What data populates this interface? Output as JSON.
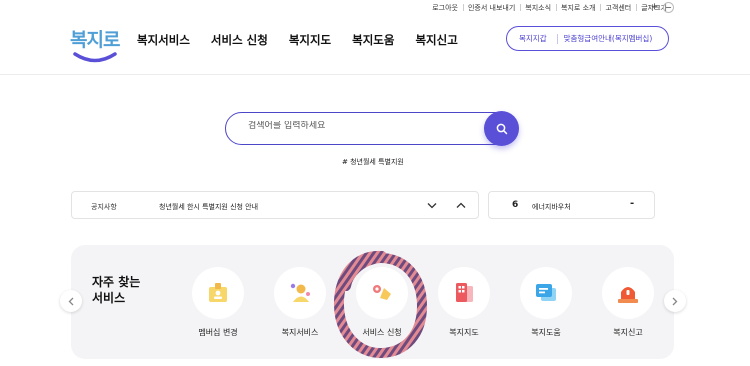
{
  "util_links": [
    "로그아웃",
    "인증서 내보내기",
    "복지소식",
    "복지로 소개",
    "고객센터",
    "글자크기"
  ],
  "font_size": {
    "increase": "+",
    "decrease": "−"
  },
  "logo": {
    "text": "복지로"
  },
  "gnb": [
    "복지서비스",
    "서비스 신청",
    "복지지도",
    "복지도움",
    "복지신고"
  ],
  "header_buttons": {
    "wallet": "복지지갑",
    "membership": "맞춤형급여안내(복지멤버십)"
  },
  "search": {
    "placeholder": "검색어를 입력하세요",
    "hashtag": "# 청년월세 특별지원"
  },
  "notice": {
    "label": "공지사항",
    "text": "청년월세 한시 특별지원 신청 안내"
  },
  "voucher": {
    "number": "6",
    "text": "에너지바우처",
    "dash": "-"
  },
  "frequent": {
    "title_line1": "자주 찾는",
    "title_line2": "서비스",
    "items": [
      {
        "label": "멤버십 변경",
        "icon": "membership-icon"
      },
      {
        "label": "복지서비스",
        "icon": "welfare-service-icon"
      },
      {
        "label": "서비스 신청",
        "icon": "service-apply-icon"
      },
      {
        "label": "복지지도",
        "icon": "welfare-map-icon"
      },
      {
        "label": "복지도움",
        "icon": "welfare-help-icon"
      },
      {
        "label": "복지신고",
        "icon": "welfare-report-icon"
      }
    ]
  },
  "colors": {
    "accent": "#5a50d8",
    "logo": "#4f9fd6",
    "panel": "#f4f4f6",
    "annotation": "#7a4a6a"
  }
}
